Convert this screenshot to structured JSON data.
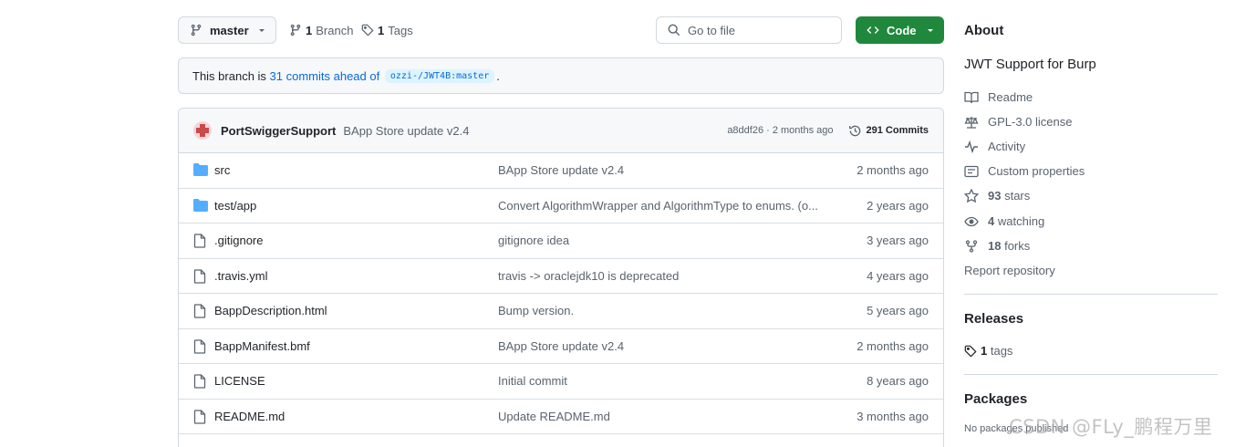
{
  "toolbar": {
    "branch": "master",
    "branches_count": "1",
    "branches_label": "Branch",
    "tags_count": "1",
    "tags_label": "Tags",
    "go_to_file_placeholder": "Go to file",
    "code_label": "Code"
  },
  "notice": {
    "prefix": "This branch is ",
    "ahead": "31 commits ahead of",
    "upstream": "ozzi-/JWT4B:master",
    "suffix": "."
  },
  "latest_commit": {
    "author": "PortSwiggerSupport",
    "message": "BApp Store update v2.4",
    "hash_and_time": "a8ddf26 · 2 months ago",
    "commits": "291 Commits"
  },
  "files": [
    {
      "type": "folder",
      "name": "src",
      "message": "BApp Store update v2.4",
      "age": "2 months ago"
    },
    {
      "type": "folder",
      "name": "test/app",
      "message": "Convert AlgorithmWrapper and AlgorithmType to enums. (o...",
      "age": "2 years ago"
    },
    {
      "type": "file",
      "name": ".gitignore",
      "message": "gitignore idea",
      "age": "3 years ago"
    },
    {
      "type": "file",
      "name": ".travis.yml",
      "message": "travis -> oraclejdk10 is deprecated",
      "age": "4 years ago"
    },
    {
      "type": "file",
      "name": "BappDescription.html",
      "message": "Bump version.",
      "age": "5 years ago"
    },
    {
      "type": "file",
      "name": "BappManifest.bmf",
      "message": "BApp Store update v2.4",
      "age": "2 months ago"
    },
    {
      "type": "file",
      "name": "LICENSE",
      "message": "Initial commit",
      "age": "8 years ago"
    },
    {
      "type": "file",
      "name": "README.md",
      "message": "Update README.md",
      "age": "3 months ago"
    }
  ],
  "about": {
    "heading": "About",
    "description": "JWT Support for Burp",
    "readme": "Readme",
    "license": "GPL-3.0 license",
    "activity": "Activity",
    "custom_properties": "Custom properties",
    "stars_count": "93",
    "stars_label": "stars",
    "watching_count": "4",
    "watching_label": "watching",
    "forks_count": "18",
    "forks_label": "forks",
    "report": "Report repository"
  },
  "releases": {
    "heading": "Releases",
    "tags_count": "1",
    "tags_label": "tags"
  },
  "packages": {
    "heading": "Packages",
    "empty": "No packages published"
  },
  "watermark": "CSDN @FLy_鹏程万里",
  "colors": {
    "accent": "#0969da",
    "code_button": "#1f883d",
    "folder": "#54aeff"
  }
}
